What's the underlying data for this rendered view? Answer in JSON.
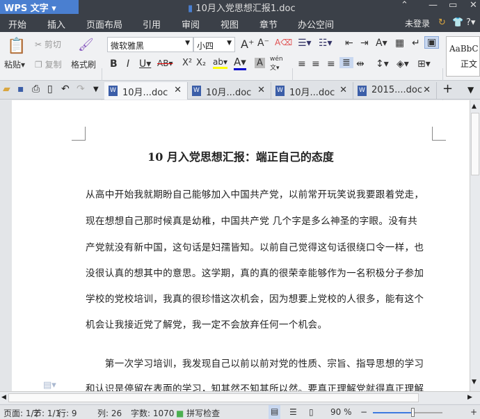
{
  "app": {
    "name": "WPS 文字",
    "doc_title": "10月入党思想汇报1.doc"
  },
  "menu": [
    "开始",
    "插入",
    "页面布局",
    "引用",
    "审阅",
    "视图",
    "章节",
    "办公空间"
  ],
  "account": "未登录",
  "ribbon": {
    "paste": "粘贴",
    "cut": "剪切",
    "copy": "复制",
    "format_painter": "格式刷",
    "font": "微软雅黑",
    "size": "小四",
    "style_preview": "AaBbC",
    "style_name": "正文"
  },
  "tabs": [
    {
      "label": "10月...doc"
    },
    {
      "label": "10月...doc"
    },
    {
      "label": "10月...doc"
    },
    {
      "label": "2015....doc"
    }
  ],
  "document": {
    "title": "10 月入党思想汇报：端正自己的态度",
    "lines": [
      "从高中开始我就期盼自己能够加入中国共产党，以前常开玩笑说我要跟着党走，",
      "现在想想自己那时候真是幼稚，中国共产党  几个字是多么神圣的字眼。没有共",
      "产党就没有新中国，这句话是妇孺皆知。以前自己觉得这句话很绕口令一样，也",
      "没很认真的想其中的意思。这学期，真的真的很荣幸能够作为一名积极分子参加",
      "学校的党校培训，我真的很珍惜这次机会，因为想要上党校的人很多，能有这个",
      "机会让我接近党了解党，我一定不会放弃任何一个机会。",
      "　　第一次学习培训，我发现自己以前以前对党的性质、宗旨、指导思想的学习",
      "和认识是停留在表面的学习，知其然不知其所以然。要真正理解党就得真正理解"
    ]
  },
  "status": {
    "page": "页面: 1/2",
    "section": "节: 1/1",
    "row": "行: 9",
    "col": "列: 26",
    "words": "字数: 1070",
    "spell": "拼写检查",
    "zoom": "90 %",
    "zoom_value": 90
  }
}
